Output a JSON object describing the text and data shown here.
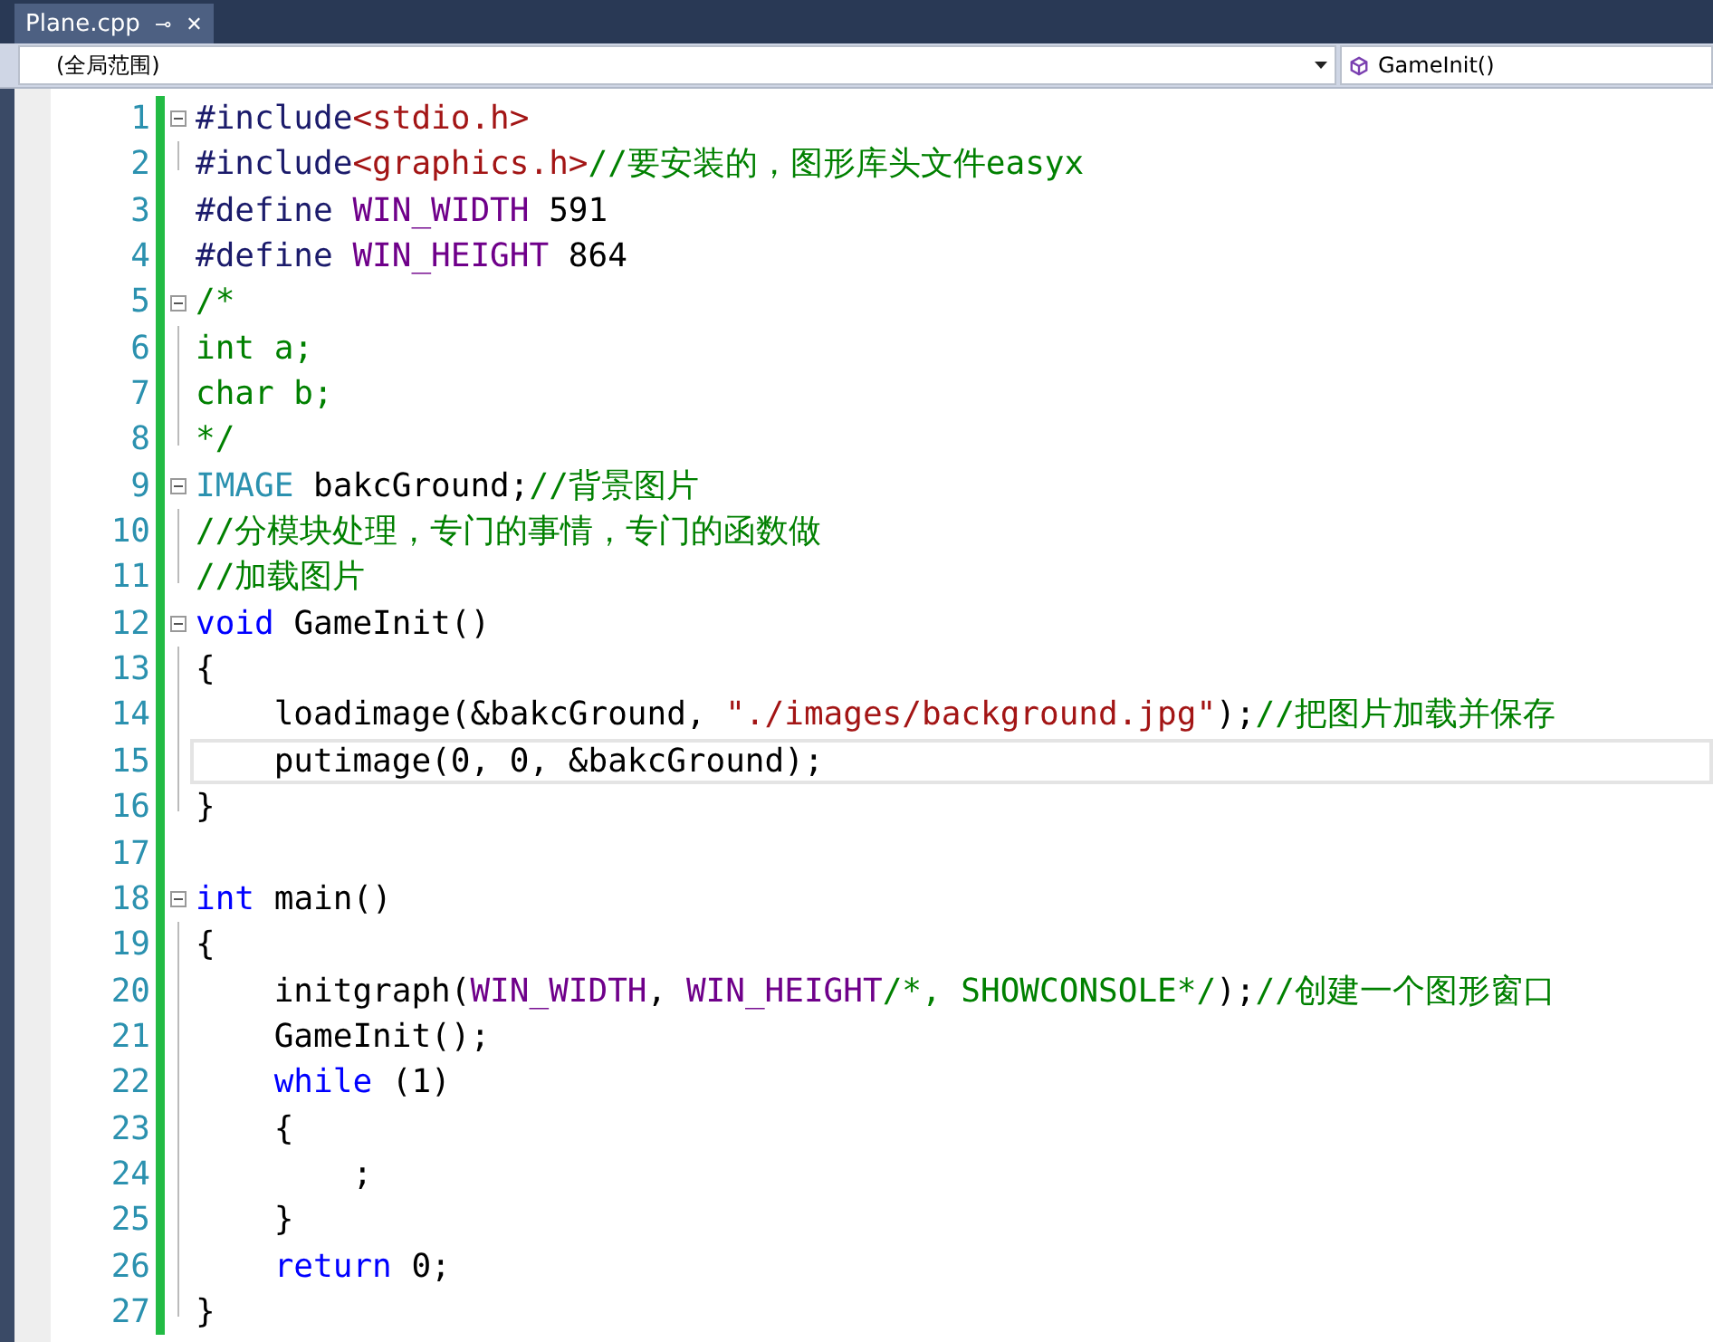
{
  "tab": {
    "label": "Plane.cpp",
    "selected": true,
    "pin": "⊸",
    "close": "✕"
  },
  "nav": {
    "scope": "(全局范围)",
    "member": "GameInit()"
  },
  "lines": [
    {
      "number": "1",
      "kind": "start",
      "current": false,
      "tokens": [
        {
          "kind": "directive",
          "text": "#include"
        },
        {
          "kind": "string",
          "text": "<stdio.h>"
        }
      ]
    },
    {
      "number": "2",
      "kind": "end",
      "current": false,
      "tokens": [
        {
          "kind": "directive",
          "text": "#include"
        },
        {
          "kind": "string",
          "text": "<graphics.h>"
        },
        {
          "kind": "comment",
          "text": "//要安装的，图形库头文件easyx"
        }
      ]
    },
    {
      "number": "3",
      "kind": "plain",
      "current": false,
      "tokens": [
        {
          "kind": "directive",
          "text": "#define "
        },
        {
          "kind": "macro",
          "text": "WIN_WIDTH"
        },
        {
          "kind": "plain",
          "text": " 591"
        }
      ]
    },
    {
      "number": "4",
      "kind": "plain",
      "current": false,
      "tokens": [
        {
          "kind": "directive",
          "text": "#define "
        },
        {
          "kind": "macro",
          "text": "WIN_HEIGHT"
        },
        {
          "kind": "plain",
          "text": " 864"
        }
      ]
    },
    {
      "number": "5",
      "kind": "start",
      "current": false,
      "tokens": [
        {
          "kind": "comment",
          "text": "/*"
        }
      ]
    },
    {
      "number": "6",
      "kind": "inner",
      "current": false,
      "tokens": [
        {
          "kind": "comment",
          "text": "int a;"
        }
      ]
    },
    {
      "number": "7",
      "kind": "inner",
      "current": false,
      "tokens": [
        {
          "kind": "comment",
          "text": "char b;"
        }
      ]
    },
    {
      "number": "8",
      "kind": "end",
      "current": false,
      "tokens": [
        {
          "kind": "comment",
          "text": "*/"
        }
      ]
    },
    {
      "number": "9",
      "kind": "start",
      "current": false,
      "tokens": [
        {
          "kind": "type",
          "text": "IMAGE"
        },
        {
          "kind": "plain",
          "text": " bakcGround;"
        },
        {
          "kind": "comment",
          "text": "//背景图片"
        }
      ]
    },
    {
      "number": "10",
      "kind": "inner",
      "current": false,
      "tokens": [
        {
          "kind": "comment",
          "text": "//分模块处理，专门的事情，专门的函数做"
        }
      ]
    },
    {
      "number": "11",
      "kind": "end",
      "current": false,
      "tokens": [
        {
          "kind": "comment",
          "text": "//加载图片"
        }
      ]
    },
    {
      "number": "12",
      "kind": "start",
      "current": false,
      "tokens": [
        {
          "kind": "keyword",
          "text": "void"
        },
        {
          "kind": "plain",
          "text": " GameInit()"
        }
      ]
    },
    {
      "number": "13",
      "kind": "inner",
      "current": false,
      "tokens": [
        {
          "kind": "plain",
          "text": "{"
        }
      ]
    },
    {
      "number": "14",
      "kind": "inner",
      "current": false,
      "tokens": [
        {
          "kind": "plain",
          "text": "    loadimage(&bakcGround, "
        },
        {
          "kind": "string",
          "text": "\"./images/background.jpg\""
        },
        {
          "kind": "plain",
          "text": ");"
        },
        {
          "kind": "comment",
          "text": "//把图片加载并保存"
        }
      ]
    },
    {
      "number": "15",
      "kind": "inner",
      "current": true,
      "tokens": [
        {
          "kind": "plain",
          "text": "    putimage(0, 0, &bakcGround);"
        }
      ]
    },
    {
      "number": "16",
      "kind": "end",
      "current": false,
      "tokens": [
        {
          "kind": "plain",
          "text": "}"
        }
      ]
    },
    {
      "number": "17",
      "kind": "plain",
      "current": false
    },
    {
      "number": "18",
      "kind": "start",
      "current": false,
      "tokens": [
        {
          "kind": "keyword",
          "text": "int"
        },
        {
          "kind": "plain",
          "text": " main()"
        }
      ]
    },
    {
      "number": "19",
      "kind": "inner",
      "current": false,
      "tokens": [
        {
          "kind": "plain",
          "text": "{"
        }
      ]
    },
    {
      "number": "20",
      "kind": "inner",
      "current": false,
      "tokens": [
        {
          "kind": "plain",
          "text": "    initgraph("
        },
        {
          "kind": "macro",
          "text": "WIN_WIDTH"
        },
        {
          "kind": "plain",
          "text": ", "
        },
        {
          "kind": "macro",
          "text": "WIN_HEIGHT"
        },
        {
          "kind": "comment",
          "text": "/*, SHOWCONSOLE*/"
        },
        {
          "kind": "plain",
          "text": ");"
        },
        {
          "kind": "comment",
          "text": "//创建一个图形窗口"
        }
      ]
    },
    {
      "number": "21",
      "kind": "inner",
      "current": false,
      "tokens": [
        {
          "kind": "plain",
          "text": "    GameInit();"
        }
      ]
    },
    {
      "number": "22",
      "kind": "inner",
      "current": false,
      "tokens": [
        {
          "kind": "keyword",
          "text": "    while"
        },
        {
          "kind": "plain",
          "text": " (1)"
        }
      ]
    },
    {
      "number": "23",
      "kind": "inner",
      "current": false,
      "tokens": [
        {
          "kind": "plain",
          "text": "    {"
        }
      ]
    },
    {
      "number": "24",
      "kind": "inner",
      "current": false,
      "tokens": [
        {
          "kind": "plain",
          "text": "        ;"
        }
      ]
    },
    {
      "number": "25",
      "kind": "inner",
      "current": false,
      "tokens": [
        {
          "kind": "plain",
          "text": "    }"
        }
      ]
    },
    {
      "number": "26",
      "kind": "inner",
      "current": false,
      "tokens": [
        {
          "kind": "keyword",
          "text": "    return"
        },
        {
          "kind": "plain",
          "text": " 0;"
        }
      ]
    },
    {
      "number": "27",
      "kind": "end",
      "current": false,
      "tokens": [
        {
          "kind": "plain",
          "text": "}"
        }
      ]
    }
  ]
}
